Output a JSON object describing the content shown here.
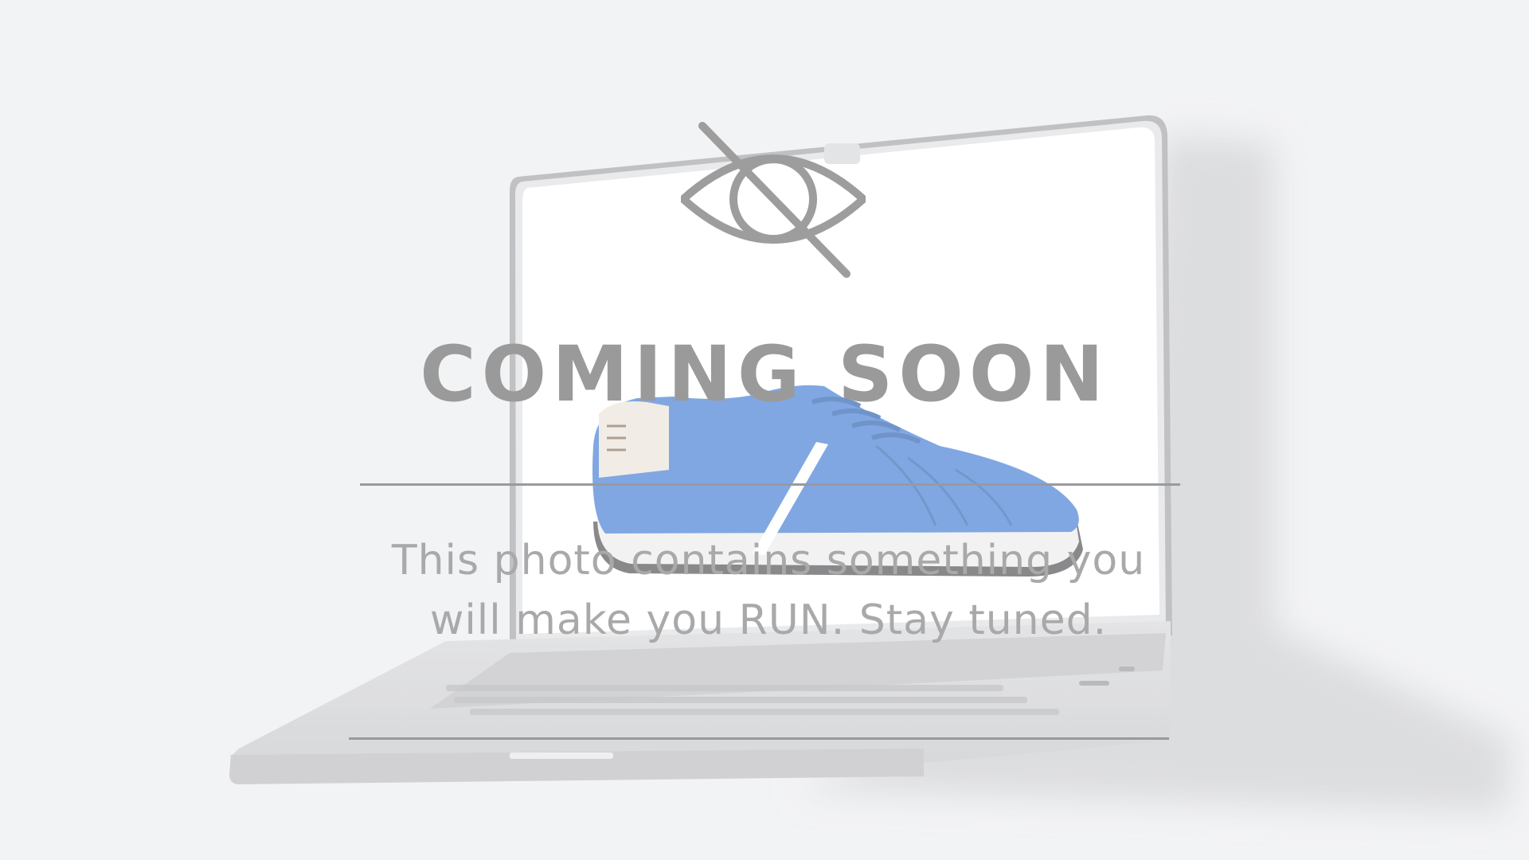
{
  "title": "COMING SOON",
  "message_line1": "This photo contains something you",
  "message_line2": "will make you RUN. Stay tuned.",
  "icons": {
    "status": "eye-slash-icon"
  },
  "colors": {
    "background": "#eeeff1",
    "text": "#9a9a9a",
    "shoe": "#4f86d6",
    "laptop": "#d4d5d8"
  }
}
